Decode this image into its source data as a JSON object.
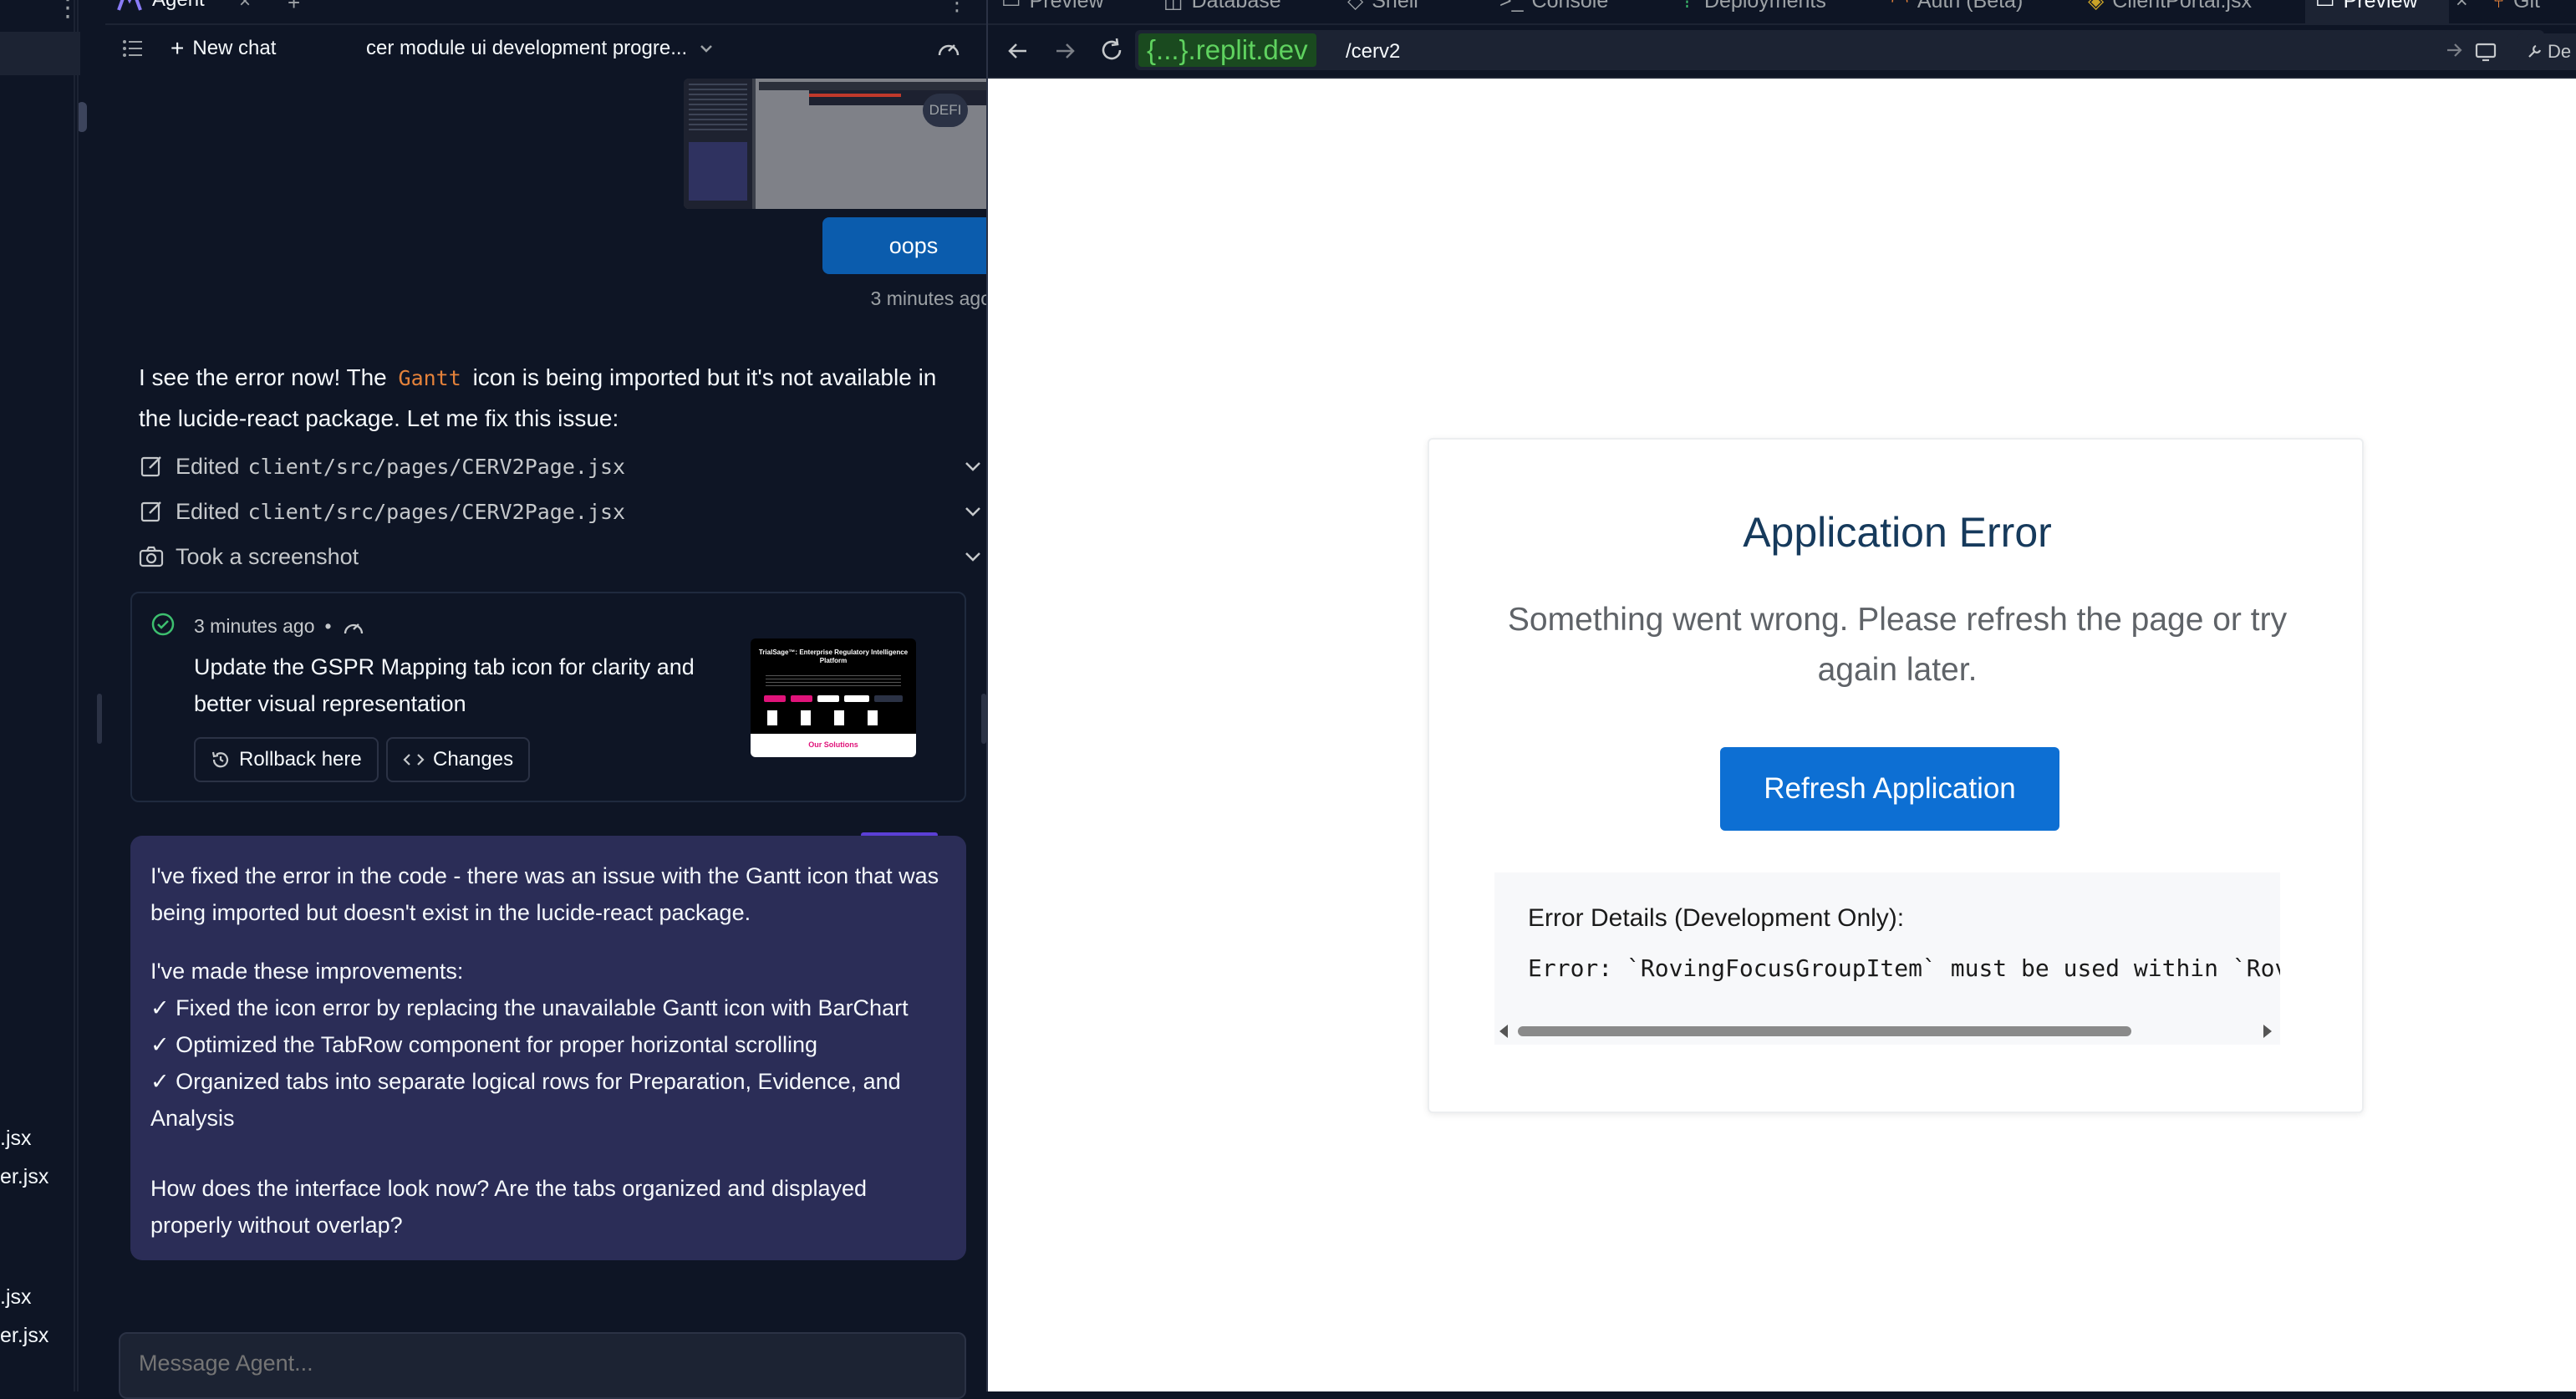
{
  "left_files": [
    {
      "name": ".jsx"
    },
    {
      "name": "er.jsx"
    },
    {
      "name": ".jsx"
    },
    {
      "name": "er.jsx"
    }
  ],
  "agent_tab": {
    "label": "Agent"
  },
  "toolbar": {
    "new_chat": "New chat",
    "chat_title": "cer module ui development progre..."
  },
  "user_message": {
    "avatar_text": "DEFI",
    "text": "oops",
    "time": "3 minutes ago"
  },
  "agent_reply": {
    "text_before": "I see the error now! The",
    "code": "Gantt",
    "text_after": "icon is being imported but it's not available in the lucide-react package. Let me fix this issue:"
  },
  "actions": [
    {
      "verb": "Edited",
      "path": "client/src/pages/CERV2Page.jsx"
    },
    {
      "verb": "Edited",
      "path": "client/src/pages/CERV2Page.jsx"
    },
    {
      "verb": "Took a screenshot",
      "path": ""
    }
  ],
  "checkpoint": {
    "time": "3 minutes ago",
    "sep": "•",
    "title": "Update the GSPR Mapping tab icon for clarity and better visual representation",
    "rollback_label": "Rollback here",
    "changes_label": "Changes",
    "thumb_heading": "TrialSage™: Enterprise Regulatory Intelligence Platform",
    "thumb_link": "Our Solutions"
  },
  "summary": {
    "p1": "I've fixed the error in the code - there was an issue with the Gantt icon that was being imported but doesn't exist in the lucide-react package.",
    "p2_heading": "I've made these improvements:",
    "items": [
      "✓ Fixed the icon error by replacing the unavailable Gantt icon with BarChart",
      "✓ Optimized the TabRow component for proper horizontal scrolling",
      "✓ Organized tabs into separate logical rows for Preparation, Evidence, and Analysis"
    ],
    "p3": "How does the interface look now? Are the tabs organized and displayed properly without overlap?"
  },
  "input": {
    "placeholder": "Message Agent..."
  },
  "right_tabs": [
    {
      "label": "Preview",
      "icon": "monitor-icon"
    },
    {
      "label": "Database",
      "icon": "database-icon"
    },
    {
      "label": "Shell",
      "icon": "shell-icon"
    },
    {
      "label": "Console",
      "icon": "terminal-icon"
    },
    {
      "label": "Deployments",
      "icon": "deploy-icon"
    },
    {
      "label": "Auth (Beta)",
      "icon": "user-icon"
    },
    {
      "label": "ClientPortal.jsx",
      "icon": "file-icon"
    },
    {
      "label": "Preview",
      "icon": "monitor-icon"
    },
    {
      "label": "Git",
      "icon": "git-icon"
    }
  ],
  "url": {
    "domain": "{...}.replit.dev",
    "path": "/cerv2",
    "devtools": "De"
  },
  "error_page": {
    "title": "Application Error",
    "message": "Something went wrong. Please refresh the page or try again later.",
    "button": "Refresh Application",
    "details_heading": "Error Details (Development Only):",
    "details_text": "Error: `RovingFocusGroupItem` must be used within `RovingFocusGroup`"
  },
  "colors": {
    "bg": "#0e1525",
    "accent_blue": "#0b5cad",
    "error_title": "#163a5c",
    "refresh_button": "#0d6fd3",
    "bubble": "#2b2d57",
    "url_green": "#5fd25f",
    "code_orange": "#e5823a"
  }
}
